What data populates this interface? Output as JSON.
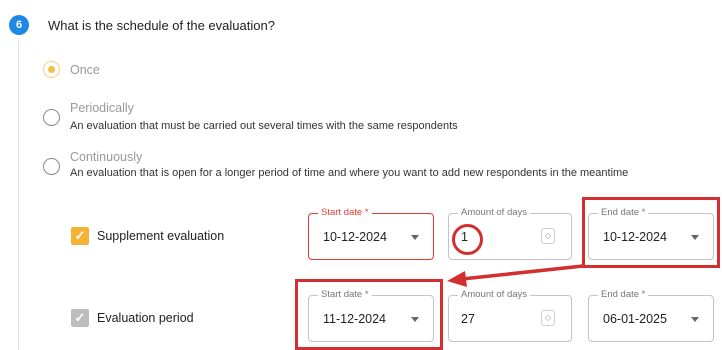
{
  "question": {
    "number": "6",
    "title": "What is the schedule of the evaluation?"
  },
  "options": [
    {
      "label": "Once",
      "description": "",
      "selected": true
    },
    {
      "label": "Periodically",
      "description": "An evaluation that must be carried out several times with the same respondents",
      "selected": false
    },
    {
      "label": "Continuously",
      "description": "An evaluation that is open for a longer period of time and where you want to add new respondents in the meantime",
      "selected": false
    }
  ],
  "rows": [
    {
      "label": "Supplement evaluation",
      "checked": true,
      "checkbox_style": "orange",
      "start_date": {
        "label": "Start date *",
        "value": "10-12-2024",
        "error": true
      },
      "amount_of_days": {
        "label": "Amount of days",
        "value": "1"
      },
      "end_date": {
        "label": "End date *",
        "value": "10-12-2024"
      }
    },
    {
      "label": "Evaluation period",
      "checked": true,
      "checkbox_style": "grey",
      "start_date": {
        "label": "Start date *",
        "value": "11-12-2024",
        "error": false
      },
      "amount_of_days": {
        "label": "Amount of days",
        "value": "27"
      },
      "end_date": {
        "label": "End date *",
        "value": "06-01-2025"
      }
    }
  ],
  "icons": {
    "checkbox": "check-icon",
    "dropdown": "caret-down-icon",
    "spinner": "number-spinner-icon"
  },
  "colors": {
    "badge": "#1e88e5",
    "radio_selected": "#f5c04a",
    "checkbox_checked": "#f5b335",
    "checkbox_disabled": "#bdbdbd",
    "error": "#e53935",
    "annotation": "#d32f2f"
  }
}
